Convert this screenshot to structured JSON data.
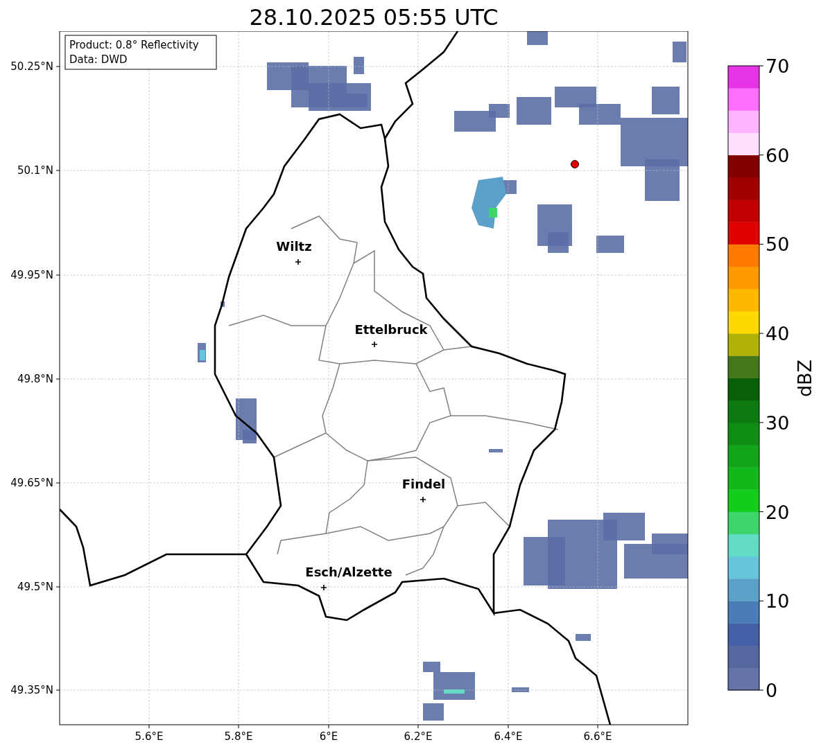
{
  "title": "28.10.2025 05:55 UTC",
  "info_box": {
    "lines": [
      "Product: 0.8° Reflectivity",
      "Data: DWD"
    ]
  },
  "map": {
    "y_ticks": [
      "50.25°N",
      "50.1°N",
      "49.95°N",
      "49.8°N",
      "49.65°N",
      "49.5°N",
      "49.35°N"
    ],
    "x_ticks": [
      "5.6°E",
      "5.8°E",
      "6°E",
      "6.2°E",
      "6.4°E",
      "6.6°E"
    ],
    "cities": [
      {
        "name": "Wiltz"
      },
      {
        "name": "Ettelbruck"
      },
      {
        "name": "Findel"
      },
      {
        "name": "Esch/Alzette"
      }
    ]
  },
  "colorbar": {
    "label": "dBZ",
    "ticks": [
      "70",
      "60",
      "50",
      "40",
      "30",
      "20",
      "10",
      "0"
    ],
    "segments": [
      {
        "color": "#6474a8"
      },
      {
        "color": "#56669e"
      },
      {
        "color": "#4460a6"
      },
      {
        "color": "#4a7db8"
      },
      {
        "color": "#5aa0c8"
      },
      {
        "color": "#66c4dc"
      },
      {
        "color": "#62dcc4"
      },
      {
        "color": "#3ed66c"
      },
      {
        "color": "#14cc1a"
      },
      {
        "color": "#12b81a"
      },
      {
        "color": "#12a41a"
      },
      {
        "color": "#108e14"
      },
      {
        "color": "#0e7a12"
      },
      {
        "color": "#076008"
      },
      {
        "color": "#44761a"
      },
      {
        "color": "#b0b208"
      },
      {
        "color": "#ffd800"
      },
      {
        "color": "#ffb800"
      },
      {
        "color": "#ff9a00"
      },
      {
        "color": "#ff7a00"
      },
      {
        "color": "#e00000"
      },
      {
        "color": "#c00000"
      },
      {
        "color": "#a00000"
      },
      {
        "color": "#800000"
      },
      {
        "color": "#ffe0ff"
      },
      {
        "color": "#ffb4ff"
      },
      {
        "color": "#ff6eff"
      },
      {
        "color": "#e633e6"
      }
    ]
  }
}
